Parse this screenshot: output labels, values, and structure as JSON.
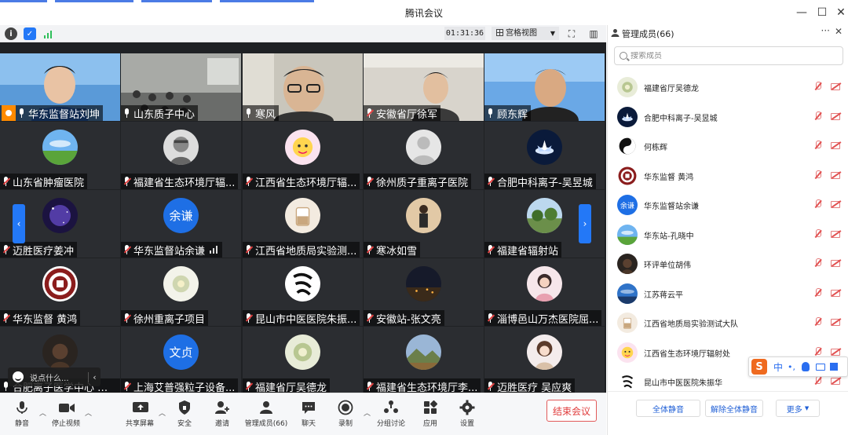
{
  "window": {
    "title": "腾讯会议"
  },
  "toolbar": {
    "timer": "01:31:36",
    "view_mode": "宫格视图"
  },
  "tiles": [
    {
      "name": "华东监督站刘坤",
      "type": "video",
      "host": true,
      "muted": false,
      "scene": "man-blue"
    },
    {
      "name": "山东质子中心",
      "type": "video",
      "muted": false,
      "scene": "room"
    },
    {
      "name": "寒风",
      "type": "video",
      "muted": false,
      "active": true,
      "scene": "man-glasses"
    },
    {
      "name": "安徽省厅徐军",
      "type": "video",
      "muted": true,
      "scene": "man-office"
    },
    {
      "name": "顾东辉",
      "type": "video",
      "muted": false,
      "scene": "man-sky"
    },
    {
      "name": "山东省肿瘤医院",
      "type": "avatar",
      "muted": true,
      "avatar": "grass"
    },
    {
      "name": "福建省生态环境厅辐...",
      "type": "avatar",
      "muted": true,
      "avatar": "sketch"
    },
    {
      "name": "江西省生态环境厅辐...",
      "type": "avatar",
      "muted": true,
      "avatar": "cartoon"
    },
    {
      "name": "徐州质子重离子医院",
      "type": "avatar",
      "muted": true,
      "avatar": "default"
    },
    {
      "name": "合肥中科离子-吴昱城",
      "type": "avatar",
      "muted": true,
      "avatar": "lotus"
    },
    {
      "name": "迈胜医疗姜冲",
      "type": "avatar",
      "muted": true,
      "avatar": "galaxy"
    },
    {
      "name": "华东监督站余谦",
      "type": "avatar",
      "muted": true,
      "avatar": "text",
      "avatar_text": "余谦",
      "signal": true
    },
    {
      "name": "江西省地质局实验测...",
      "type": "avatar",
      "muted": true,
      "avatar": "drink"
    },
    {
      "name": "寒冰如雪",
      "type": "avatar",
      "muted": true,
      "avatar": "person"
    },
    {
      "name": "福建省辐射站",
      "type": "avatar",
      "muted": true,
      "avatar": "trees"
    },
    {
      "name": "华东监督 黄鸿",
      "type": "avatar",
      "muted": true,
      "avatar": "seal"
    },
    {
      "name": "徐州重离子项目",
      "type": "avatar",
      "muted": true,
      "avatar": "flower"
    },
    {
      "name": "昆山市中医医院朱振...",
      "type": "avatar",
      "muted": true,
      "avatar": "calli"
    },
    {
      "name": "安徽站-张文亮",
      "type": "avatar",
      "muted": true,
      "avatar": "night"
    },
    {
      "name": "淄博邑山万杰医院屈...",
      "type": "avatar",
      "muted": true,
      "avatar": "girl"
    },
    {
      "name": "合肥离子医学中心 高楠",
      "type": "avatar",
      "muted": false,
      "avatar": "dark"
    },
    {
      "name": "上海艾普强粒子设备...",
      "type": "avatar",
      "muted": true,
      "avatar": "text",
      "avatar_text": "文贞"
    },
    {
      "name": "福建省厅吴德龙",
      "type": "avatar",
      "muted": true,
      "avatar": "flower2"
    },
    {
      "name": "福建省生态环境厅李...",
      "type": "avatar",
      "muted": true,
      "avatar": "landscape"
    },
    {
      "name": "迈胜医疗 吴应爽",
      "type": "avatar",
      "muted": true,
      "avatar": "girl2"
    }
  ],
  "chat_input": {
    "placeholder": "说点什么..."
  },
  "bottombar": {
    "mute": "静音",
    "stop_video": "停止视频",
    "share_screen": "共享屏幕",
    "security": "安全",
    "invite": "邀请",
    "members": "管理成员(66)",
    "chat": "聊天",
    "record": "录制",
    "breakout": "分组讨论",
    "apps": "应用",
    "settings": "设置",
    "end_meeting": "结束会议"
  },
  "panel": {
    "title": "管理成员(66)",
    "search_placeholder": "搜索成员",
    "members": [
      {
        "name": "福建省厅吴德龙",
        "avatar": "flower2"
      },
      {
        "name": "合肥中科离子-吴昱城",
        "avatar": "lotus"
      },
      {
        "name": "何栋辉",
        "avatar": "taiji"
      },
      {
        "name": "华东监督 黄鸿",
        "avatar": "seal"
      },
      {
        "name": "华东监督站余谦",
        "avatar": "text",
        "avatar_text": "余谦"
      },
      {
        "name": "华东站-孔晓中",
        "avatar": "grass"
      },
      {
        "name": "环评单位胡伟",
        "avatar": "dark"
      },
      {
        "name": "江苏蒋云平",
        "avatar": "sky"
      },
      {
        "name": "江西省地质局实验测试大队",
        "avatar": "drink"
      },
      {
        "name": "江西省生态环境厅辐射处",
        "avatar": "cartoon"
      },
      {
        "name": "昆山市中医医院朱振华",
        "avatar": "calli"
      }
    ],
    "mute_all": "全体静音",
    "unmute_all": "解除全体静音",
    "more": "更多"
  },
  "ime": {
    "lang": "中",
    "brand": "S"
  },
  "colors": {
    "accent": "#2378f7",
    "danger": "#e03c3c",
    "host": "#ff8a00",
    "active_speaker": "#2fd36b"
  }
}
